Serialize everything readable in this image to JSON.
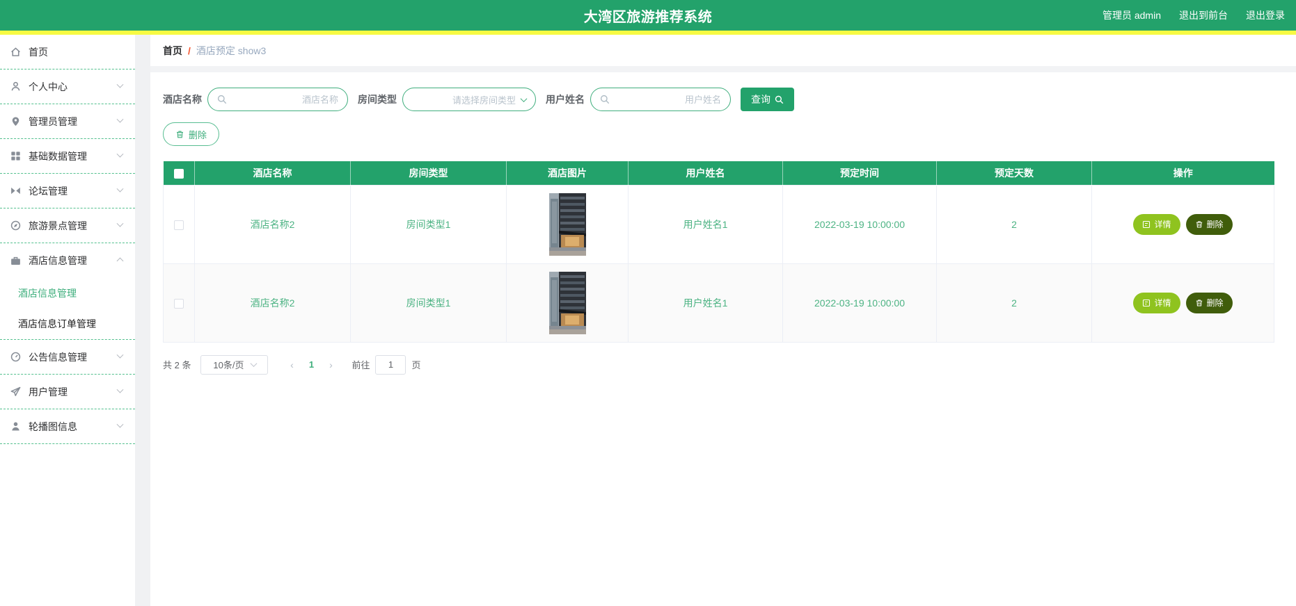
{
  "header": {
    "title": "大湾区旅游推荐系统",
    "user": "管理员 admin",
    "to_front": "退出到前台",
    "logout": "退出登录"
  },
  "sidebar": {
    "items": [
      {
        "label": "首页",
        "icon": "home-icon"
      },
      {
        "label": "个人中心",
        "icon": "user-icon"
      },
      {
        "label": "管理员管理",
        "icon": "location-pin-icon"
      },
      {
        "label": "基础数据管理",
        "icon": "grid-icon"
      },
      {
        "label": "论坛管理",
        "icon": "forum-icon"
      },
      {
        "label": "旅游景点管理",
        "icon": "compass-icon"
      },
      {
        "label": "酒店信息管理",
        "icon": "briefcase-icon",
        "expanded": true,
        "children": [
          {
            "label": "酒店信息管理",
            "highlighted": true
          },
          {
            "label": "酒店信息订单管理",
            "current": true
          }
        ]
      },
      {
        "label": "公告信息管理",
        "icon": "gauge-icon"
      },
      {
        "label": "用户管理",
        "icon": "paper-plane-icon"
      },
      {
        "label": "轮播图信息",
        "icon": "person-icon"
      }
    ]
  },
  "breadcrumb": {
    "home": "首页",
    "separator": "/",
    "current": "酒店预定 show3"
  },
  "filters": {
    "hotel_name_label": "酒店名称",
    "hotel_name_placeholder": "酒店名称",
    "room_type_label": "房间类型",
    "room_type_placeholder": "请选择房间类型",
    "user_name_label": "用户姓名",
    "user_name_placeholder": "用户姓名",
    "query_button": "查询",
    "delete_button": "删除"
  },
  "table": {
    "columns": [
      "酒店名称",
      "房间类型",
      "酒店图片",
      "用户姓名",
      "预定时间",
      "预定天数",
      "操作"
    ],
    "rows": [
      {
        "hotel_name": "酒店名称2",
        "room_type": "房间类型1",
        "image": "hotel-building-photo",
        "user_name": "用户姓名1",
        "time": "2022-03-19 10:00:00",
        "days": "2",
        "detail_button": "详情",
        "delete_button": "删除"
      },
      {
        "hotel_name": "酒店名称2",
        "room_type": "房间类型1",
        "image": "hotel-building-photo",
        "user_name": "用户姓名1",
        "time": "2022-03-19 10:00:00",
        "days": "2",
        "detail_button": "详情",
        "delete_button": "删除"
      }
    ]
  },
  "pagination": {
    "total": "共 2 条",
    "page_size": "10条/页",
    "prev": "‹",
    "current_page": "1",
    "next": "›",
    "goto_label": "前往",
    "goto_value": "1",
    "page_unit": "页"
  },
  "colors": {
    "primary_green": "#23a26b",
    "accent_yellow": "#f7fa43",
    "cell_text_green": "#4cb383",
    "detail_button_bg": "#8fc31f",
    "delete_button_bg": "#405d0b",
    "breadcrumb_separator": "#f5552e"
  }
}
